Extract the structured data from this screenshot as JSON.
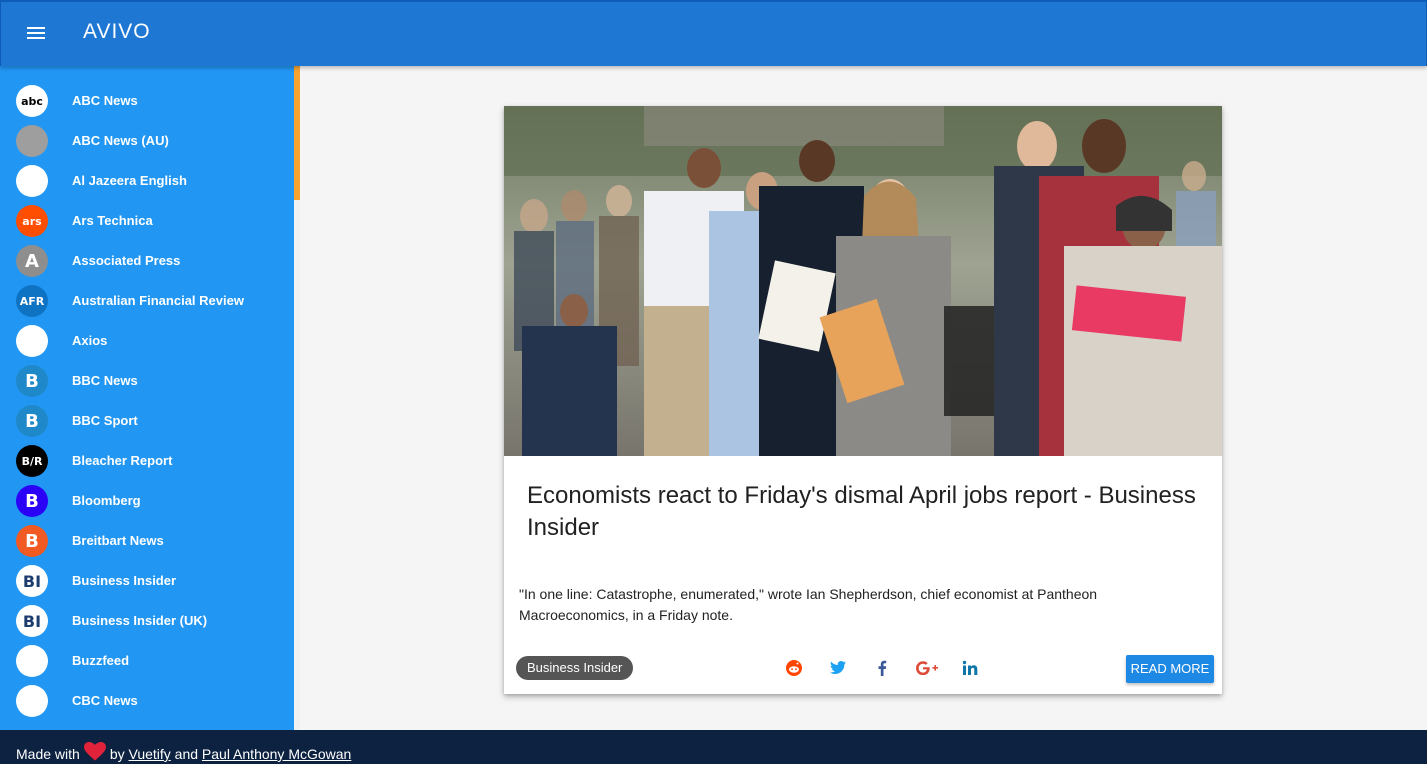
{
  "app": {
    "title": "AVIVO"
  },
  "sidebar": {
    "items": [
      {
        "label": "ABC News",
        "logo_text": "abc",
        "logo_color": "#ffffff",
        "logo_text_color": "#000000"
      },
      {
        "label": "ABC News (AU)",
        "logo_text": "",
        "logo_color": "#9e9e9e",
        "logo_text_color": "#ffffff"
      },
      {
        "label": "Al Jazeera English",
        "logo_text": "",
        "logo_color": "#ffffff",
        "logo_text_color": "#d4a017"
      },
      {
        "label": "Ars Technica",
        "logo_text": "ars",
        "logo_color": "#ff4e00",
        "logo_text_color": "#ffffff"
      },
      {
        "label": "Associated Press",
        "logo_text": "A",
        "logo_color": "#8e8e8e",
        "logo_text_color": "#ffffff"
      },
      {
        "label": "Australian Financial Review",
        "logo_text": "AFR",
        "logo_color": "#0f73c4",
        "logo_text_color": "#ffffff"
      },
      {
        "label": "Axios",
        "logo_text": "",
        "logo_color": "#ffffff",
        "logo_text_color": "#000000"
      },
      {
        "label": "BBC News",
        "logo_text": "B",
        "logo_color": "#1e88c8",
        "logo_text_color": "#ffffff"
      },
      {
        "label": "BBC Sport",
        "logo_text": "B",
        "logo_color": "#1e88c8",
        "logo_text_color": "#ffffff"
      },
      {
        "label": "Bleacher Report",
        "logo_text": "B/R",
        "logo_color": "#000000",
        "logo_text_color": "#ffffff"
      },
      {
        "label": "Bloomberg",
        "logo_text": "B",
        "logo_color": "#2b00f7",
        "logo_text_color": "#ffffff"
      },
      {
        "label": "Breitbart News",
        "logo_text": "B",
        "logo_color": "#f15a22",
        "logo_text_color": "#ffffff"
      },
      {
        "label": "Business Insider",
        "logo_text": "BI",
        "logo_color": "#ffffff",
        "logo_text_color": "#1d3d70"
      },
      {
        "label": "Business Insider (UK)",
        "logo_text": "BI",
        "logo_color": "#ffffff",
        "logo_text_color": "#1d3d70"
      },
      {
        "label": "Buzzfeed",
        "logo_text": "",
        "logo_color": "#ffffff",
        "logo_text_color": "#ee3322"
      },
      {
        "label": "CBC News",
        "logo_text": "",
        "logo_color": "#ffffff",
        "logo_text_color": "#d81e05"
      }
    ]
  },
  "article": {
    "headline": "Economists react to Friday's dismal April jobs report - Business Insider",
    "summary": "\"In one line: Catastrophe, enumerated,\" wrote Ian Shepherdson, chief economist at Pantheon Macroeconomics, in a Friday note.",
    "source_chip": "Business Insider",
    "read_more": "READ MORE",
    "share_icons": [
      "reddit-icon",
      "twitter-icon",
      "facebook-icon",
      "google-plus-icon",
      "linkedin-icon"
    ]
  },
  "footer": {
    "made_with": "Made with",
    "by": "by",
    "vuetify": "Vuetify",
    "and": "and",
    "author": "Paul Anthony McGowan"
  },
  "colors": {
    "toolbar": "#1e77d3",
    "sidebar": "#2196f3",
    "footer": "#0d2240",
    "read_more": "#1e88e5",
    "scroll_accent": "#f7a330"
  }
}
